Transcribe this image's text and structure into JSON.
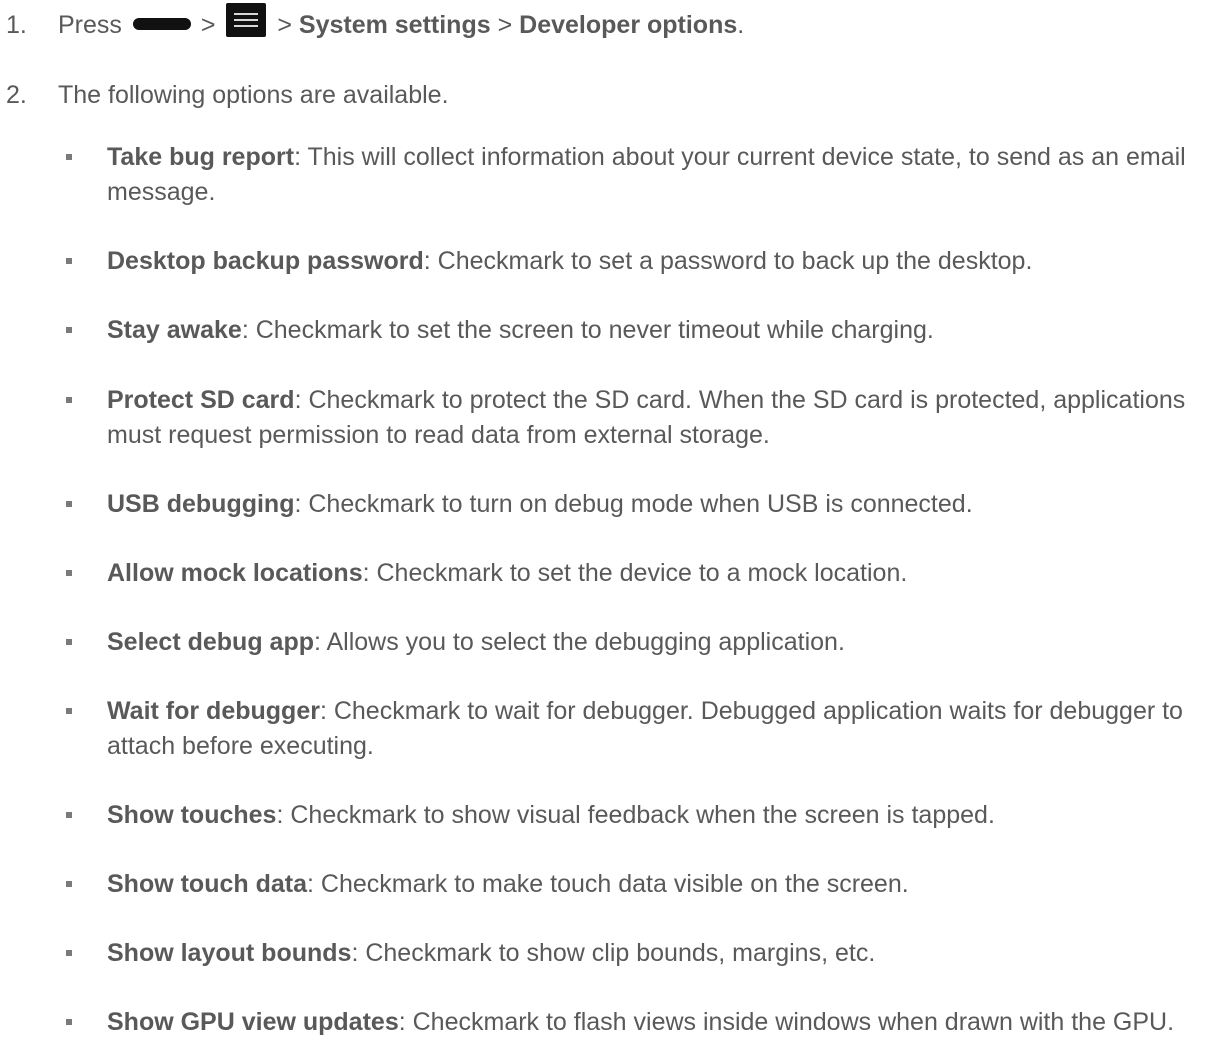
{
  "steps": [
    {
      "num": "1.",
      "press": "Press",
      "sep": ">",
      "system_settings": "System settings",
      "developer_options": "Developer options",
      "end": "."
    },
    {
      "num": "2.",
      "text": "The following options are available."
    }
  ],
  "icons": {
    "home": "home-key-icon",
    "menu": "menu-key-icon"
  },
  "options": [
    {
      "title": "Take bug report",
      "desc": ": This will collect information about your current device state, to send as an email message."
    },
    {
      "title": "Desktop backup password",
      "desc": ": Checkmark to set a password to back up the desktop."
    },
    {
      "title": "Stay awake",
      "desc": ": Checkmark to set the screen to never timeout while charging."
    },
    {
      "title": "Protect SD card",
      "desc": ": Checkmark to protect the SD card. When the SD card is protected, applications must request permission to read data from external storage."
    },
    {
      "title": "USB debugging",
      "desc": ": Checkmark to turn on debug mode when USB is connected."
    },
    {
      "title": "Allow mock locations",
      "desc": ": Checkmark to set the device to a mock location."
    },
    {
      "title": "Select debug app",
      "desc": ": Allows you to select the debugging application."
    },
    {
      "title": "Wait for debugger",
      "desc": ": Checkmark to wait for debugger. Debugged application waits for debugger to attach before executing."
    },
    {
      "title": "Show touches",
      "desc": ": Checkmark to show visual feedback when the screen is tapped."
    },
    {
      "title": "Show touch data",
      "desc": ": Checkmark to make touch data visible on the screen."
    },
    {
      "title": "Show layout bounds",
      "desc": ": Checkmark to show clip bounds, margins, etc."
    },
    {
      "title": "Show GPU view updates",
      "desc": ": Checkmark to flash views inside windows when drawn with the GPU."
    }
  ]
}
